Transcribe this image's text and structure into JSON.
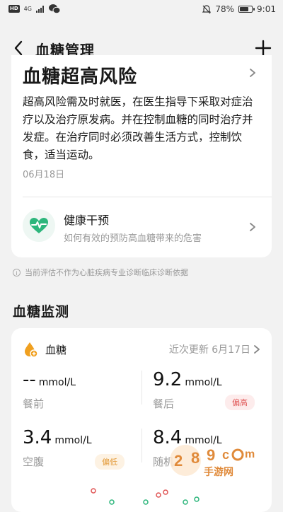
{
  "status_bar": {
    "left_badge": "HD",
    "signal": "4G",
    "battery_percent": "78%",
    "battery_level": 0.78,
    "time": "9:01"
  },
  "nav": {
    "title": "血糖管理"
  },
  "risk_card": {
    "title": "血糖超高风险",
    "description": "超高风险需及时就医，在医生指导下采取对症治疗以及治疗原发病。并在控制血糖的同时治疗并发症。在治疗同时必须改善生活方式，控制饮食，适当运动。",
    "date": "06月18日",
    "health": {
      "title": "健康干预",
      "subtitle": "如何有效的预防高血糖带来的危害"
    }
  },
  "note": "当前评估不作为心脏疾病专业诊断临床诊断依据",
  "monitor": {
    "section_title": "血糖监测",
    "card_title": "血糖",
    "updated": "近次更新 6月17日",
    "readings": [
      {
        "value": "--",
        "unit": "mmol/L",
        "label": "餐前"
      },
      {
        "value": "9.2",
        "unit": "mmol/L",
        "label": "餐后",
        "badge": "偏高"
      },
      {
        "value": "3.4",
        "unit": "mmol/L",
        "label": "空腹",
        "badge": "偏低"
      },
      {
        "value": "8.4",
        "unit": "mmol/L",
        "label": "随机"
      }
    ]
  },
  "watermark": {
    "text": "手游网"
  },
  "colors": {
    "accent_green": "#2db67c",
    "drop_orange": "#f0a020",
    "high_red": "#e05555",
    "low_orange": "#e39b3a"
  }
}
